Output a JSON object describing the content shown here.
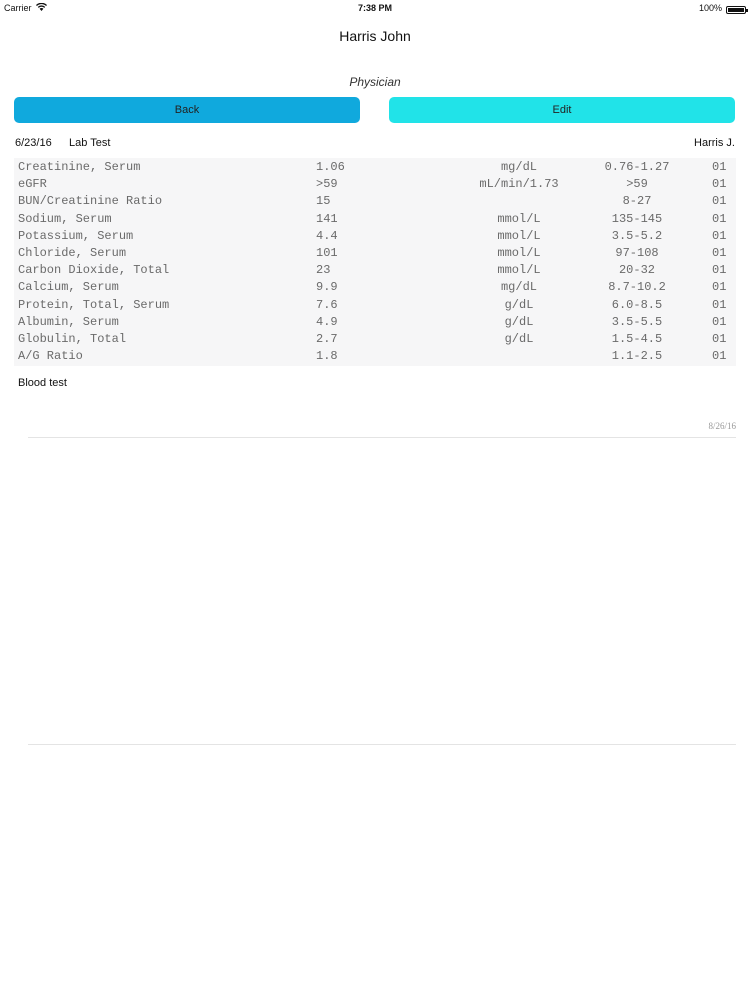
{
  "status_bar": {
    "carrier": "Carrier",
    "time": "7:38 PM",
    "battery": "100%"
  },
  "header": {
    "title": "Harris John",
    "subtitle": "Physician"
  },
  "buttons": {
    "back": "Back",
    "edit": "Edit"
  },
  "record": {
    "date": "6/23/16",
    "type": "Lab Test",
    "doctor": "Harris J."
  },
  "lab_results": [
    {
      "name": "Creatinine, Serum",
      "value": "1.06",
      "unit": "mg/dL",
      "range": "0.76-1.27",
      "flag": "01"
    },
    {
      "name": "eGFR",
      "value": ">59",
      "unit": "mL/min/1.73",
      "range": ">59",
      "flag": "01"
    },
    {
      "name": "BUN/Creatinine Ratio",
      "value": "15",
      "unit": "",
      "range": "8-27",
      "flag": "01"
    },
    {
      "name": "Sodium, Serum",
      "value": "141",
      "unit": "mmol/L",
      "range": "135-145",
      "flag": "01"
    },
    {
      "name": "Potassium, Serum",
      "value": "4.4",
      "unit": "mmol/L",
      "range": "3.5-5.2",
      "flag": "01"
    },
    {
      "name": "Chloride, Serum",
      "value": "101",
      "unit": "mmol/L",
      "range": "97-108",
      "flag": "01"
    },
    {
      "name": "Carbon Dioxide, Total",
      "value": "23",
      "unit": "mmol/L",
      "range": "20-32",
      "flag": "01"
    },
    {
      "name": "Calcium, Serum",
      "value": "9.9",
      "unit": "mg/dL",
      "range": "8.7-10.2",
      "flag": "01"
    },
    {
      "name": "Protein, Total, Serum",
      "value": "7.6",
      "unit": "g/dL",
      "range": "6.0-8.5",
      "flag": "01"
    },
    {
      "name": "Albumin, Serum",
      "value": "4.9",
      "unit": "g/dL",
      "range": "3.5-5.5",
      "flag": "01"
    },
    {
      "name": "Globulin, Total",
      "value": "2.7",
      "unit": "g/dL",
      "range": "1.5-4.5",
      "flag": "01"
    },
    {
      "name": "A/G Ratio",
      "value": "1.8",
      "unit": "",
      "range": "1.1-2.5",
      "flag": "01"
    }
  ],
  "note": {
    "text": "Blood test",
    "date": "8/26/16"
  },
  "colors": {
    "back_button": "#10a9dd",
    "edit_button": "#21e3e8"
  }
}
